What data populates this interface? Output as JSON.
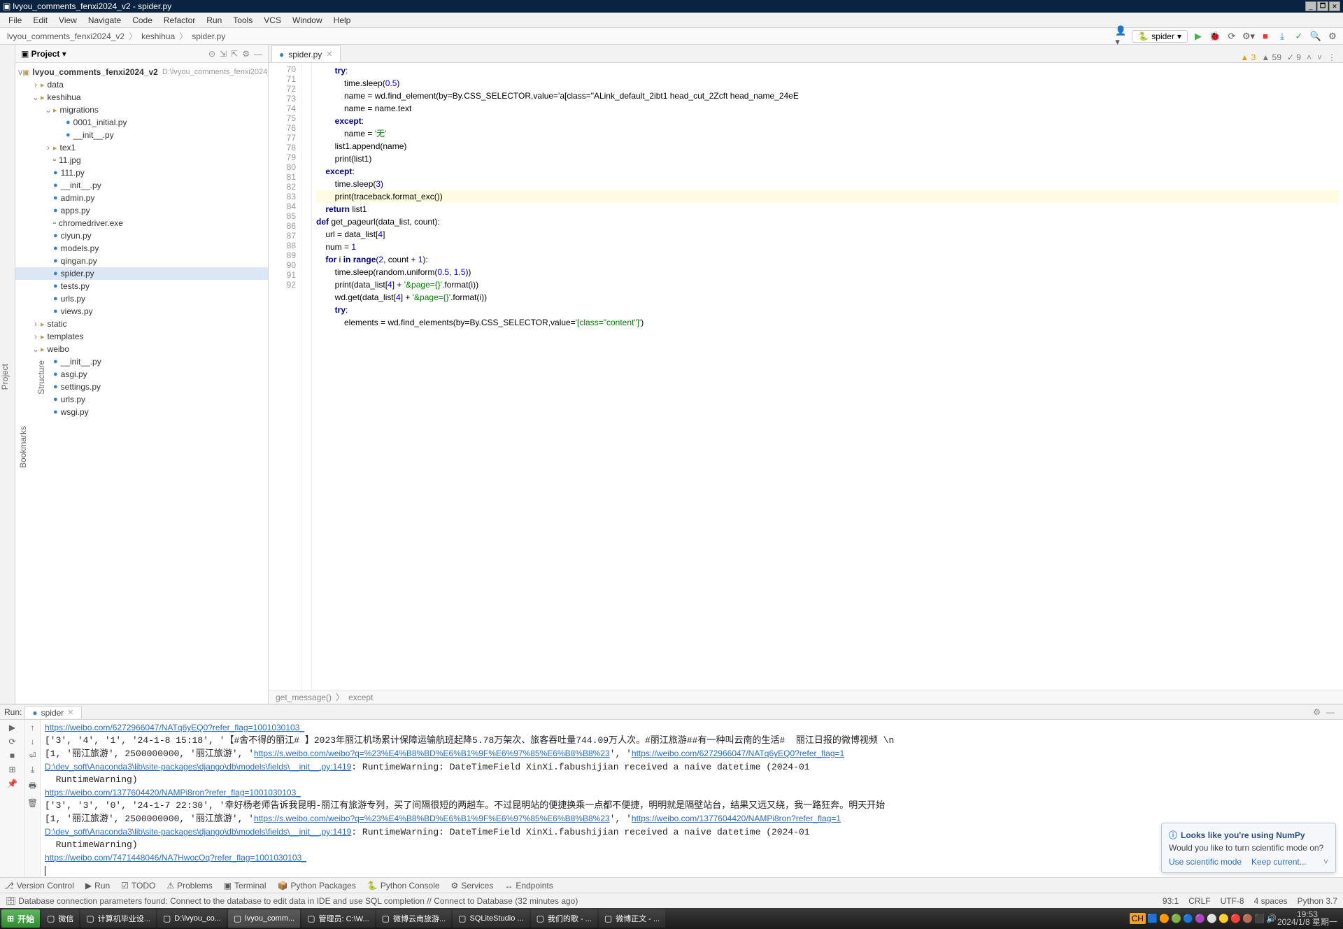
{
  "title": "lvyou_comments_fenxi2024_v2 - spider.py",
  "menu": [
    "File",
    "Edit",
    "View",
    "Navigate",
    "Code",
    "Refactor",
    "Run",
    "Tools",
    "VCS",
    "Window",
    "Help"
  ],
  "breadcrumb": [
    "lvyou_comments_fenxi2024_v2",
    "keshihua",
    "spider.py"
  ],
  "runConfig": "spider",
  "project": {
    "title": "Project",
    "root": {
      "name": "lvyou_comments_fenxi2024_v2",
      "path": "D:\\lvyou_comments_fenxi2024_v2"
    },
    "tree": [
      {
        "d": 1,
        "t": "dir",
        "n": "data",
        "exp": false,
        "tw": ">"
      },
      {
        "d": 1,
        "t": "dir",
        "n": "keshihua",
        "exp": true,
        "tw": "v"
      },
      {
        "d": 2,
        "t": "dir",
        "n": "migrations",
        "exp": true,
        "tw": "v"
      },
      {
        "d": 3,
        "t": "py",
        "n": "0001_initial.py"
      },
      {
        "d": 3,
        "t": "py",
        "n": "__init__.py"
      },
      {
        "d": 2,
        "t": "dir",
        "n": "tex1",
        "exp": false,
        "tw": ">"
      },
      {
        "d": 2,
        "t": "file",
        "n": "11.jpg"
      },
      {
        "d": 2,
        "t": "py",
        "n": "111.py"
      },
      {
        "d": 2,
        "t": "py",
        "n": "__init__.py"
      },
      {
        "d": 2,
        "t": "py",
        "n": "admin.py"
      },
      {
        "d": 2,
        "t": "py",
        "n": "apps.py"
      },
      {
        "d": 2,
        "t": "file",
        "n": "chromedriver.exe"
      },
      {
        "d": 2,
        "t": "py",
        "n": "ciyun.py"
      },
      {
        "d": 2,
        "t": "py",
        "n": "models.py"
      },
      {
        "d": 2,
        "t": "py",
        "n": "qingan.py"
      },
      {
        "d": 2,
        "t": "py",
        "n": "spider.py",
        "sel": true
      },
      {
        "d": 2,
        "t": "py",
        "n": "tests.py"
      },
      {
        "d": 2,
        "t": "py",
        "n": "urls.py"
      },
      {
        "d": 2,
        "t": "py",
        "n": "views.py"
      },
      {
        "d": 1,
        "t": "dir",
        "n": "static",
        "exp": false,
        "tw": ">"
      },
      {
        "d": 1,
        "t": "dir",
        "n": "templates",
        "exp": false,
        "tw": ">"
      },
      {
        "d": 1,
        "t": "dir",
        "n": "weibo",
        "exp": true,
        "tw": "v"
      },
      {
        "d": 2,
        "t": "py",
        "n": "__init__.py"
      },
      {
        "d": 2,
        "t": "py",
        "n": "asgi.py"
      },
      {
        "d": 2,
        "t": "py",
        "n": "settings.py"
      },
      {
        "d": 2,
        "t": "py",
        "n": "urls.py"
      },
      {
        "d": 2,
        "t": "py",
        "n": "wsgi.py"
      }
    ]
  },
  "editor": {
    "tab": "spider.py",
    "inspection": {
      "warn": 3,
      "weak": 59,
      "typo": 9
    },
    "startLine": 70,
    "breadcrumb": [
      "get_message()",
      "except"
    ],
    "lines": [
      {
        "n": 70,
        "i": 8,
        "t": "try:",
        "kw": true
      },
      {
        "n": 71,
        "i": 12,
        "t": "time.sleep(0.5)"
      },
      {
        "n": 72,
        "i": 12,
        "t": "name = wd.find_element(by=By.CSS_SELECTOR,value='a[class=\"ALink_default_2ibt1 head_cut_2Zcft head_name_24eE"
      },
      {
        "n": 73,
        "i": 12,
        "t": "name = name.text"
      },
      {
        "n": 74,
        "i": 8,
        "t": "except:",
        "kw": true
      },
      {
        "n": 75,
        "i": 12,
        "t": "name = '无'"
      },
      {
        "n": 76,
        "i": 8,
        "t": "list1.append(name)"
      },
      {
        "n": 77,
        "i": 8,
        "t": "print(list1)"
      },
      {
        "n": 78,
        "i": 4,
        "t": "except:",
        "kw": true
      },
      {
        "n": 79,
        "i": 8,
        "t": "time.sleep(3)"
      },
      {
        "n": 80,
        "i": 8,
        "t": "print(traceback.format_exc())",
        "hl": true
      },
      {
        "n": 81,
        "i": 0,
        "t": ""
      },
      {
        "n": 82,
        "i": 4,
        "t": "return list1",
        "kw": true
      },
      {
        "n": 83,
        "i": 0,
        "t": ""
      },
      {
        "n": 84,
        "i": 0,
        "t": "def get_pageurl(data_list, count):",
        "kw": true
      },
      {
        "n": 85,
        "i": 4,
        "t": "url = data_list[4]"
      },
      {
        "n": 86,
        "i": 4,
        "t": "num = 1"
      },
      {
        "n": 87,
        "i": 4,
        "t": "for i in range(2, count + 1):",
        "kw": true
      },
      {
        "n": 88,
        "i": 8,
        "t": "time.sleep(random.uniform(0.5, 1.5))"
      },
      {
        "n": 89,
        "i": 8,
        "t": "print(data_list[4] + '&page={}'.format(i))"
      },
      {
        "n": 90,
        "i": 8,
        "t": "wd.get(data_list[4] + '&page={}'.format(i))"
      },
      {
        "n": 91,
        "i": 8,
        "t": "try:",
        "kw": true
      },
      {
        "n": 92,
        "i": 12,
        "t": "elements = wd.find_elements(by=By.CSS_SELECTOR,value='[class=\"content\"]')"
      }
    ]
  },
  "run": {
    "title": "Run:",
    "tab": "spider",
    "lines": [
      {
        "type": "link",
        "text": "https://weibo.com/6272966047/NATq6yEQ0?refer_flag=1001030103_"
      },
      {
        "type": "text",
        "text": "['3', '4', '1', '24-1-8 15:18', '【#舍不得的丽江# 】2023年丽江机场累计保障运输航班起降5.78万架次、旅客吞吐量744.09万人次。#丽江旅游##有一种叫云南的生活#  丽江日报的微博视频 \\n"
      },
      {
        "type": "mixed",
        "pre": "[1, '丽江旅游', 2500000000, '丽江旅游', '",
        "link": "https://s.weibo.com/weibo?q=%23%E4%B8%BD%E6%B1%9F%E6%97%85%E6%B8%B8%23",
        "mid": "', '",
        "link2": "https://weibo.com/6272966047/NATq6yEQ0?refer_flag=1"
      },
      {
        "type": "warn",
        "loc": "D:\\dev_soft\\Anaconda3\\lib\\site-packages\\django\\db\\models\\fields\\__init__.py:1419",
        "msg": ": RuntimeWarning: DateTimeField XinXi.fabushijian received a naive datetime (2024-01"
      },
      {
        "type": "text",
        "text": "  RuntimeWarning)"
      },
      {
        "type": "link",
        "text": "https://weibo.com/1377604420/NAMPi8ron?refer_flag=1001030103_"
      },
      {
        "type": "text",
        "text": "['3', '3', '0', '24-1-7 22:30', '幸好杨老师告诉我昆明-丽江有旅游专列，买了间隔很短的两趟车。不过昆明站的便捷换乘一点都不便捷，明明就是隔壁站台，结果又远又绕，我一路狂奔。明天开始"
      },
      {
        "type": "mixed",
        "pre": "[1, '丽江旅游', 2500000000, '丽江旅游', '",
        "link": "https://s.weibo.com/weibo?q=%23%E4%B8%BD%E6%B1%9F%E6%97%85%E6%B8%B8%23",
        "mid": "', '",
        "link2": "https://weibo.com/1377604420/NAMPi8ron?refer_flag=1"
      },
      {
        "type": "warn",
        "loc": "D:\\dev_soft\\Anaconda3\\lib\\site-packages\\django\\db\\models\\fields\\__init__.py:1419",
        "msg": ": RuntimeWarning: DateTimeField XinXi.fabushijian received a naive datetime (2024-01"
      },
      {
        "type": "text",
        "text": "  RuntimeWarning)"
      },
      {
        "type": "link",
        "text": "https://weibo.com/7471448046/NA7HwocOq?refer_flag=1001030103_"
      }
    ]
  },
  "popup": {
    "title": "Looks like you're using NumPy",
    "body": "Would you like to turn scientific mode on?",
    "a1": "Use scientific mode",
    "a2": "Keep current..."
  },
  "toolstrip": [
    "Version Control",
    "Run",
    "TODO",
    "Problems",
    "Terminal",
    "Python Packages",
    "Python Console",
    "Services",
    "Endpoints"
  ],
  "statusbar": {
    "left": "Database connection parameters found: Connect to the database to edit data in IDE and use SQL completion // Connect to Database (32 minutes ago)",
    "right": [
      "93:1",
      "CRLF",
      "UTF-8",
      "4 spaces",
      "Python 3.7"
    ]
  },
  "taskbar": {
    "start": "开始",
    "items": [
      {
        "l": "微信"
      },
      {
        "l": "计算机毕业设..."
      },
      {
        "l": "D:\\lvyou_co..."
      },
      {
        "l": "lvyou_comm...",
        "a": true
      },
      {
        "l": "管理员: C:\\W..."
      },
      {
        "l": "微博云南旅游..."
      },
      {
        "l": "SQLiteStudio ..."
      },
      {
        "l": "我们的歌 - ..."
      },
      {
        "l": "微博正文 - ..."
      }
    ],
    "time": "19:53",
    "date": "2024/1/8 星期一"
  }
}
